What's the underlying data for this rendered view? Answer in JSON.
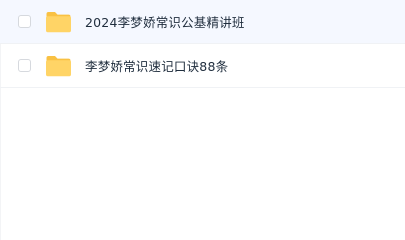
{
  "files": [
    {
      "name": "2024李梦娇常识公基精讲班",
      "type": "folder",
      "icon": "folder-icon"
    },
    {
      "name": "李梦娇常识速记口诀88条",
      "type": "folder",
      "icon": "folder-icon"
    }
  ],
  "colors": {
    "folder_body": "#FFD466",
    "folder_tab": "#F9C143",
    "row_divider": "#f0f2f5",
    "text": "#1f2d3d",
    "checkbox_border": "#d6d9de"
  }
}
